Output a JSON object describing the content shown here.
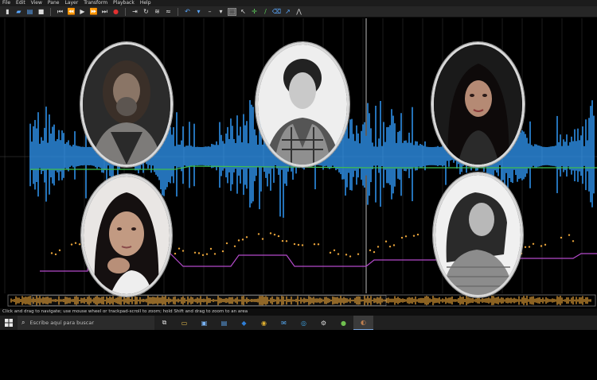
{
  "menu": [
    "File",
    "Edit",
    "View",
    "Pane",
    "Layer",
    "Transform",
    "Playback",
    "Help"
  ],
  "status_text": "Click and drag to navigate; use mouse wheel or trackpad-scroll to zoom; hold Shift and drag to zoom to an area",
  "taskbar": {
    "search_placeholder": "Escribe aquí para buscar"
  },
  "colors": {
    "waveform": "#2e8fe6",
    "pitch_track": "#e8a33a",
    "lower_track": "#b24ac9",
    "horizontal_line": "#3fbf4e"
  },
  "icons": [
    "new-icon",
    "open-icon",
    "save-icon",
    "skip-start-icon",
    "rewind-icon",
    "play-icon",
    "fast-forward-icon",
    "skip-end-icon",
    "record-icon",
    "loop-icon",
    "solo-icon",
    "cursor-icon",
    "draw-icon",
    "erase-icon",
    "measure-icon"
  ],
  "portraits": [
    {
      "tone": "#6b6258",
      "bg": "#2b2b2b",
      "style": "color"
    },
    {
      "tone": "#bdbdbd",
      "bg": "#eeeeee",
      "style": "bw"
    },
    {
      "tone": "#5b4a44",
      "bg": "#1a1a1a",
      "style": "color"
    },
    {
      "tone": "#a07a66",
      "bg": "#e9e6e4",
      "style": "color"
    },
    {
      "tone": "#b8b8b8",
      "bg": "#f0f0f0",
      "style": "bw"
    }
  ]
}
